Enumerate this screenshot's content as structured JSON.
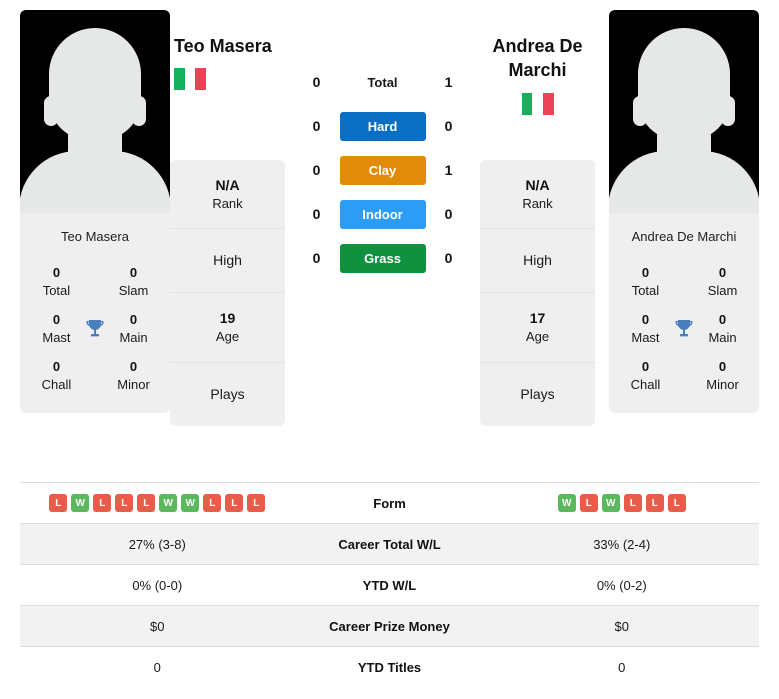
{
  "players": {
    "left": {
      "name": "Teo Masera",
      "card_name": "Teo Masera",
      "flag": "italy-flag",
      "rank": "N/A",
      "rank_label": "Rank",
      "high_label": "High",
      "age": "19",
      "age_label": "Age",
      "plays_label": "Plays",
      "titles": [
        {
          "num": "0",
          "label": "Total"
        },
        {
          "num": "0",
          "label": "Slam"
        },
        {
          "num": "0",
          "label": "Mast"
        },
        {
          "num": "0",
          "label": "Main"
        },
        {
          "num": "0",
          "label": "Chall"
        },
        {
          "num": "0",
          "label": "Minor"
        }
      ],
      "form": [
        "L",
        "W",
        "L",
        "L",
        "L",
        "W",
        "W",
        "L",
        "L",
        "L"
      ],
      "career_total_wl": "27% (3-8)",
      "ytd_wl": "0% (0-0)",
      "career_prize_money": "$0",
      "ytd_titles": "0"
    },
    "right": {
      "name": "Andrea De Marchi",
      "card_name": "Andrea De Marchi",
      "flag": "italy-flag",
      "rank": "N/A",
      "rank_label": "Rank",
      "high_label": "High",
      "age": "17",
      "age_label": "Age",
      "plays_label": "Plays",
      "titles": [
        {
          "num": "0",
          "label": "Total"
        },
        {
          "num": "0",
          "label": "Slam"
        },
        {
          "num": "0",
          "label": "Mast"
        },
        {
          "num": "0",
          "label": "Main"
        },
        {
          "num": "0",
          "label": "Chall"
        },
        {
          "num": "0",
          "label": "Minor"
        }
      ],
      "form": [
        "W",
        "L",
        "W",
        "L",
        "L",
        "L"
      ],
      "career_total_wl": "33% (2-4)",
      "ytd_wl": "0% (0-2)",
      "career_prize_money": "$0",
      "ytd_titles": "0"
    }
  },
  "head_to_head": [
    {
      "label": "Total",
      "left": "0",
      "right": "1",
      "color": ""
    },
    {
      "label": "Hard",
      "left": "0",
      "right": "0",
      "color": "#0a6fc2"
    },
    {
      "label": "Clay",
      "left": "0",
      "right": "1",
      "color": "#e08c0a"
    },
    {
      "label": "Indoor",
      "left": "0",
      "right": "0",
      "color": "#2d9cf5"
    },
    {
      "label": "Grass",
      "left": "0",
      "right": "0",
      "color": "#109140"
    }
  ],
  "stats_rows": [
    {
      "label": "Form",
      "type": "form"
    },
    {
      "label": "Career Total W/L",
      "type": "text",
      "left": "27% (3-8)",
      "right": "33% (2-4)"
    },
    {
      "label": "YTD W/L",
      "type": "text",
      "left": "0% (0-0)",
      "right": "0% (0-2)"
    },
    {
      "label": "Career Prize Money",
      "type": "text",
      "left": "$0",
      "right": "$0"
    },
    {
      "label": "YTD Titles",
      "type": "text",
      "left": "0",
      "right": "0"
    }
  ],
  "icons": {
    "trophy": "trophy-icon"
  },
  "colors": {
    "trophy": "#4a7ebb",
    "win": "#5cb85c",
    "loss": "#ea5c4a"
  }
}
